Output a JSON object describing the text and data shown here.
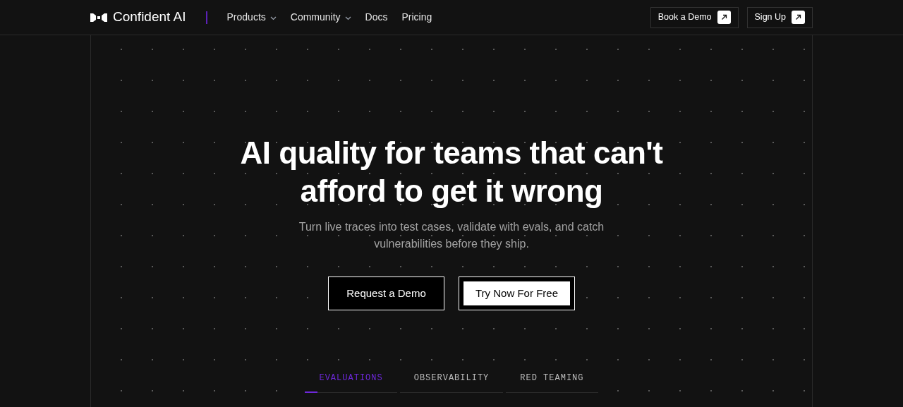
{
  "header": {
    "brand": "Confident AI",
    "nav": [
      {
        "label": "Products",
        "kind": "dropdown"
      },
      {
        "label": "Community",
        "kind": "dropdown"
      },
      {
        "label": "Docs",
        "kind": "link"
      },
      {
        "label": "Pricing",
        "kind": "link"
      }
    ],
    "actions": [
      "Book a Demo",
      "Sign Up"
    ]
  },
  "hero": {
    "title": "AI quality for teams that can't afford to get it wrong",
    "subtitle": "Turn live traces into test cases, validate with evals, and catch vulnerabilities before they ship.",
    "buttons": [
      {
        "label": "Request a Demo",
        "kind": "outline"
      },
      {
        "label": "Try Now For Free",
        "kind": "solid"
      }
    ]
  },
  "tabs": [
    {
      "label": "EVALUATIONS",
      "selected": true
    },
    {
      "label": "OBSERVABILITY",
      "selected": false
    },
    {
      "label": "RED TEAMING",
      "selected": false
    }
  ]
}
